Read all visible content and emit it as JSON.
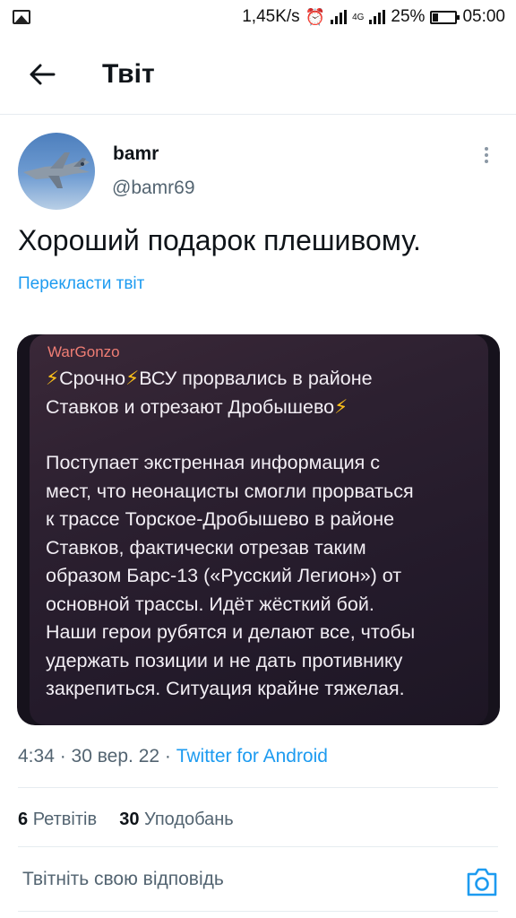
{
  "status_bar": {
    "speed": "1,45K/s",
    "network_small": "4G",
    "battery": "25%",
    "time": "05:00"
  },
  "header": {
    "title": "Твіт"
  },
  "tweet": {
    "display_name": "bamr",
    "handle": "@bamr69",
    "text": "Хороший подарок плешивому.",
    "translate_label": "Перекласти твіт",
    "media": {
      "sender": "WarGonzo",
      "lines_top": [
        "⚡Срочно⚡ВСУ прорвались в районе",
        "Ставков и отрезают Дробышево⚡"
      ],
      "lines_body": [
        "Поступает экстренная информация с",
        "мест, что неонацисты смогли прорваться",
        "к трассе Торское-Дробышево в районе",
        "Ставков, фактически отрезав таким",
        "образом Барс-13 («Русский Легион») от",
        "основной трассы. Идёт жёсткий бой.",
        "Наши герои рубятся и делают все, чтобы",
        "удержать позиции и не дать противнику",
        "закрепиться. Ситуация крайне тяжелая."
      ]
    },
    "time": "4:34",
    "date": "30 вер. 22",
    "source": "Twitter for Android",
    "retweets_count": "6",
    "retweets_label": "Ретвітів",
    "likes_count": "30",
    "likes_label": "Уподобань"
  },
  "reply": {
    "placeholder": "Твітніть свою відповідь"
  },
  "colors": {
    "accent": "#1d9bf0",
    "secondary_text": "#536471",
    "lightning": "#ffc21a",
    "sender_name": "#ef7d74"
  }
}
